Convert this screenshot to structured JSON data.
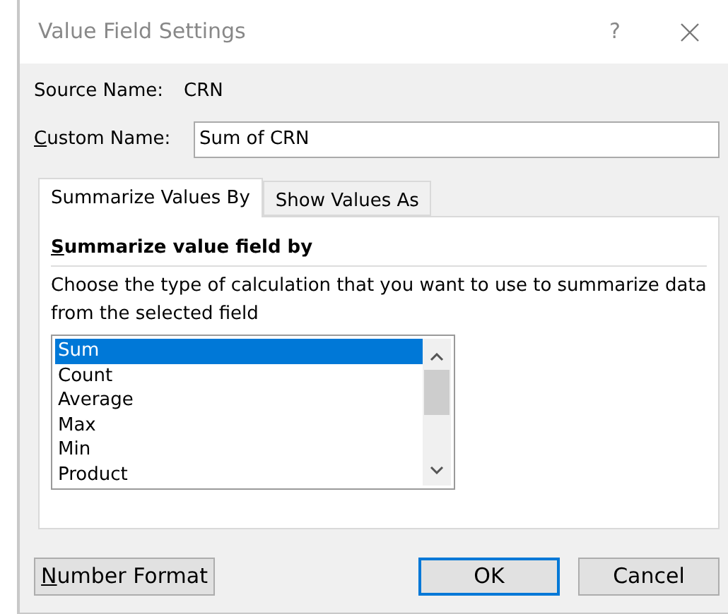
{
  "window": {
    "title": "Value Field Settings",
    "help": "?"
  },
  "source_name": {
    "label": "Source Name:",
    "value": "CRN"
  },
  "custom_name": {
    "label": "Custom Name:",
    "value": "Sum of CRN"
  },
  "tabs": [
    {
      "label": "Summarize Values By",
      "selected": true
    },
    {
      "label": "Show Values As",
      "selected": false
    }
  ],
  "section_title": "Summarize value field by",
  "description": "Choose the type of calculation that you want to use to summarize data from the selected field",
  "list_items": [
    {
      "label": "Sum",
      "selected": true
    },
    {
      "label": "Count",
      "selected": false
    },
    {
      "label": "Average",
      "selected": false
    },
    {
      "label": "Max",
      "selected": false
    },
    {
      "label": "Min",
      "selected": false
    },
    {
      "label": "Product",
      "selected": false
    }
  ],
  "buttons": [
    {
      "label": "Number Format",
      "default": false
    },
    {
      "label": "OK",
      "default": true
    },
    {
      "label": "Cancel",
      "default": false
    }
  ]
}
